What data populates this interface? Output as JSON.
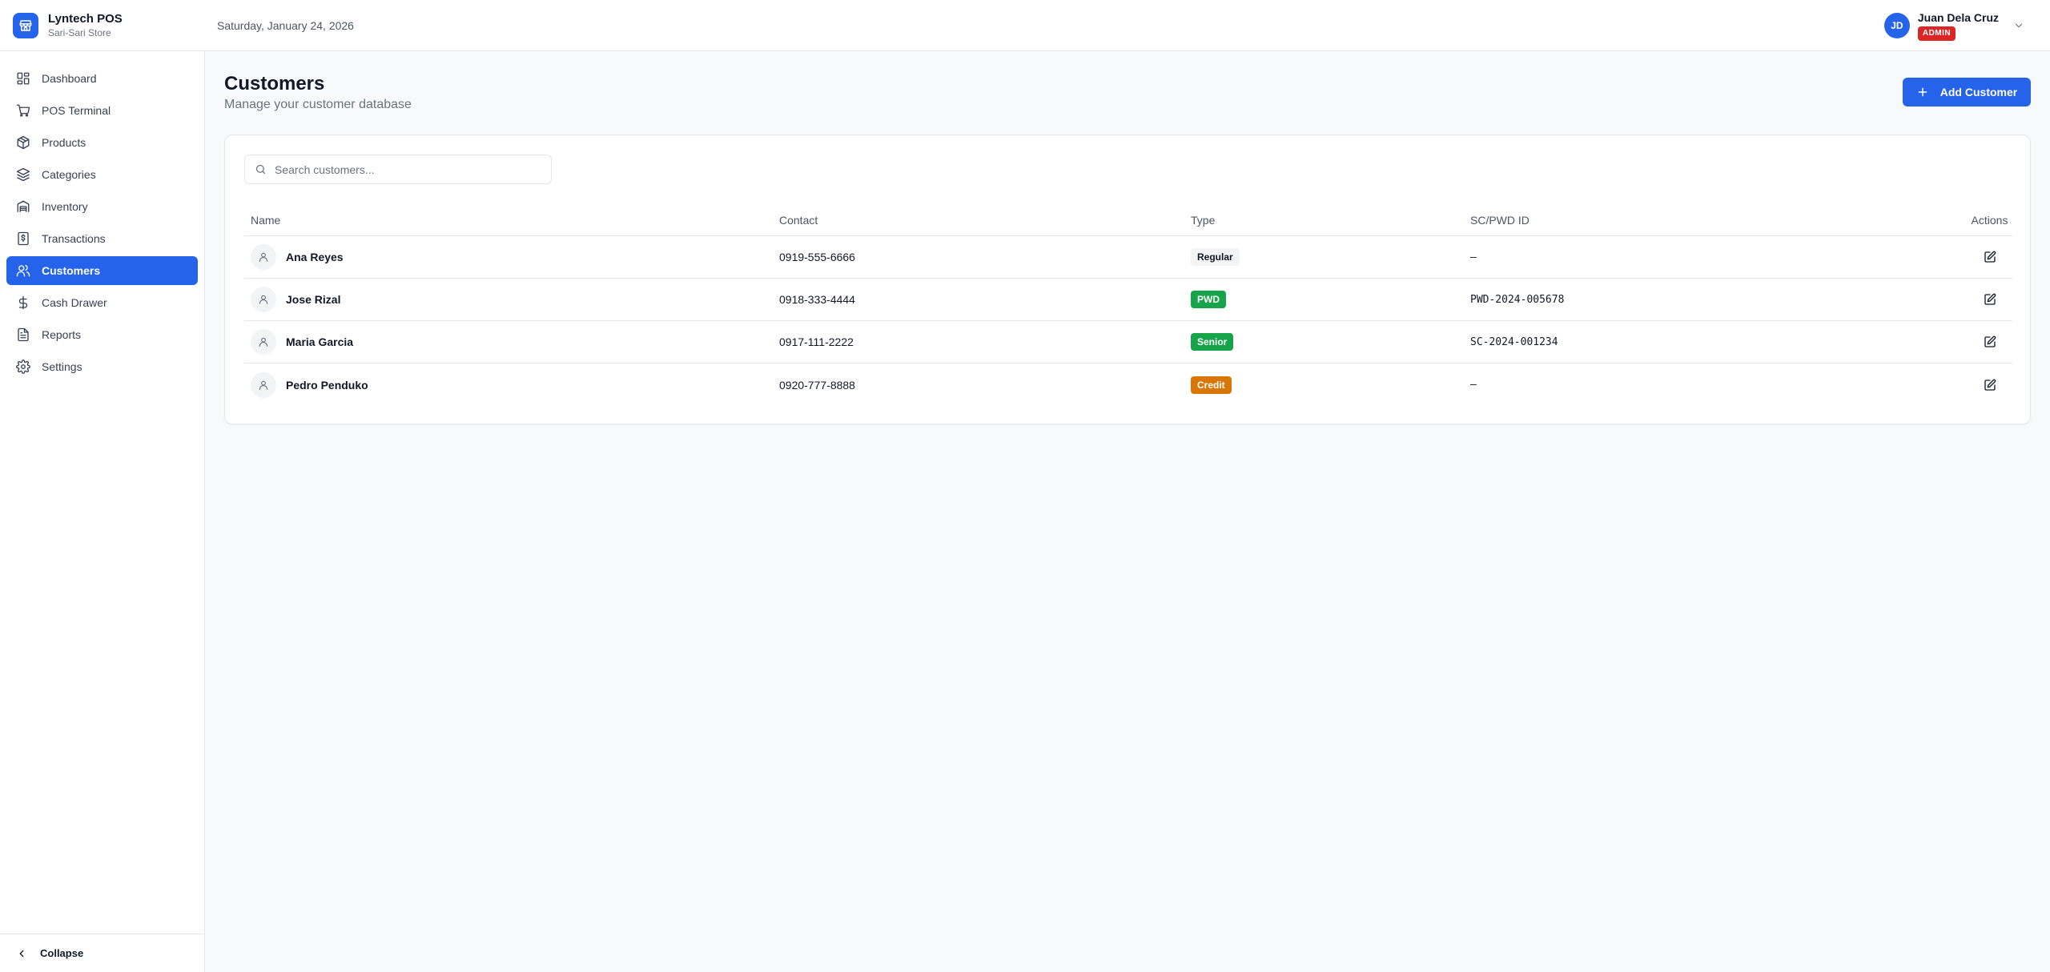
{
  "app": {
    "name": "Lyntech POS",
    "store": "Sari-Sari Store",
    "date": "Saturday, January 24, 2026",
    "brand_color": "#2563eb"
  },
  "user": {
    "initials": "JD",
    "name": "Juan Dela Cruz",
    "role": "ADMIN"
  },
  "sidebar": {
    "items": [
      {
        "label": "Dashboard",
        "icon": "dashboard-icon"
      },
      {
        "label": "POS Terminal",
        "icon": "cart-icon"
      },
      {
        "label": "Products",
        "icon": "package-icon"
      },
      {
        "label": "Categories",
        "icon": "layers-icon"
      },
      {
        "label": "Inventory",
        "icon": "warehouse-icon"
      },
      {
        "label": "Transactions",
        "icon": "receipt-icon"
      },
      {
        "label": "Customers",
        "icon": "users-icon",
        "active": true
      },
      {
        "label": "Cash Drawer",
        "icon": "dollar-icon"
      },
      {
        "label": "Reports",
        "icon": "report-icon"
      },
      {
        "label": "Settings",
        "icon": "gear-icon"
      }
    ],
    "collapse_label": "Collapse"
  },
  "page": {
    "title": "Customers",
    "subtitle": "Manage your customer database",
    "add_button": "Add Customer"
  },
  "search": {
    "placeholder": "Search customers...",
    "value": ""
  },
  "table": {
    "headers": {
      "name": "Name",
      "contact": "Contact",
      "type": "Type",
      "id": "SC/PWD ID",
      "actions": "Actions"
    },
    "rows": [
      {
        "name": "Ana Reyes",
        "contact": "0919-555-6666",
        "type": "Regular",
        "id": "–"
      },
      {
        "name": "Jose Rizal",
        "contact": "0918-333-4444",
        "type": "PWD",
        "id": "PWD-2024-005678"
      },
      {
        "name": "Maria Garcia",
        "contact": "0917-111-2222",
        "type": "Senior",
        "id": "SC-2024-001234"
      },
      {
        "name": "Pedro Penduko",
        "contact": "0920-777-8888",
        "type": "Credit",
        "id": "–"
      }
    ]
  }
}
